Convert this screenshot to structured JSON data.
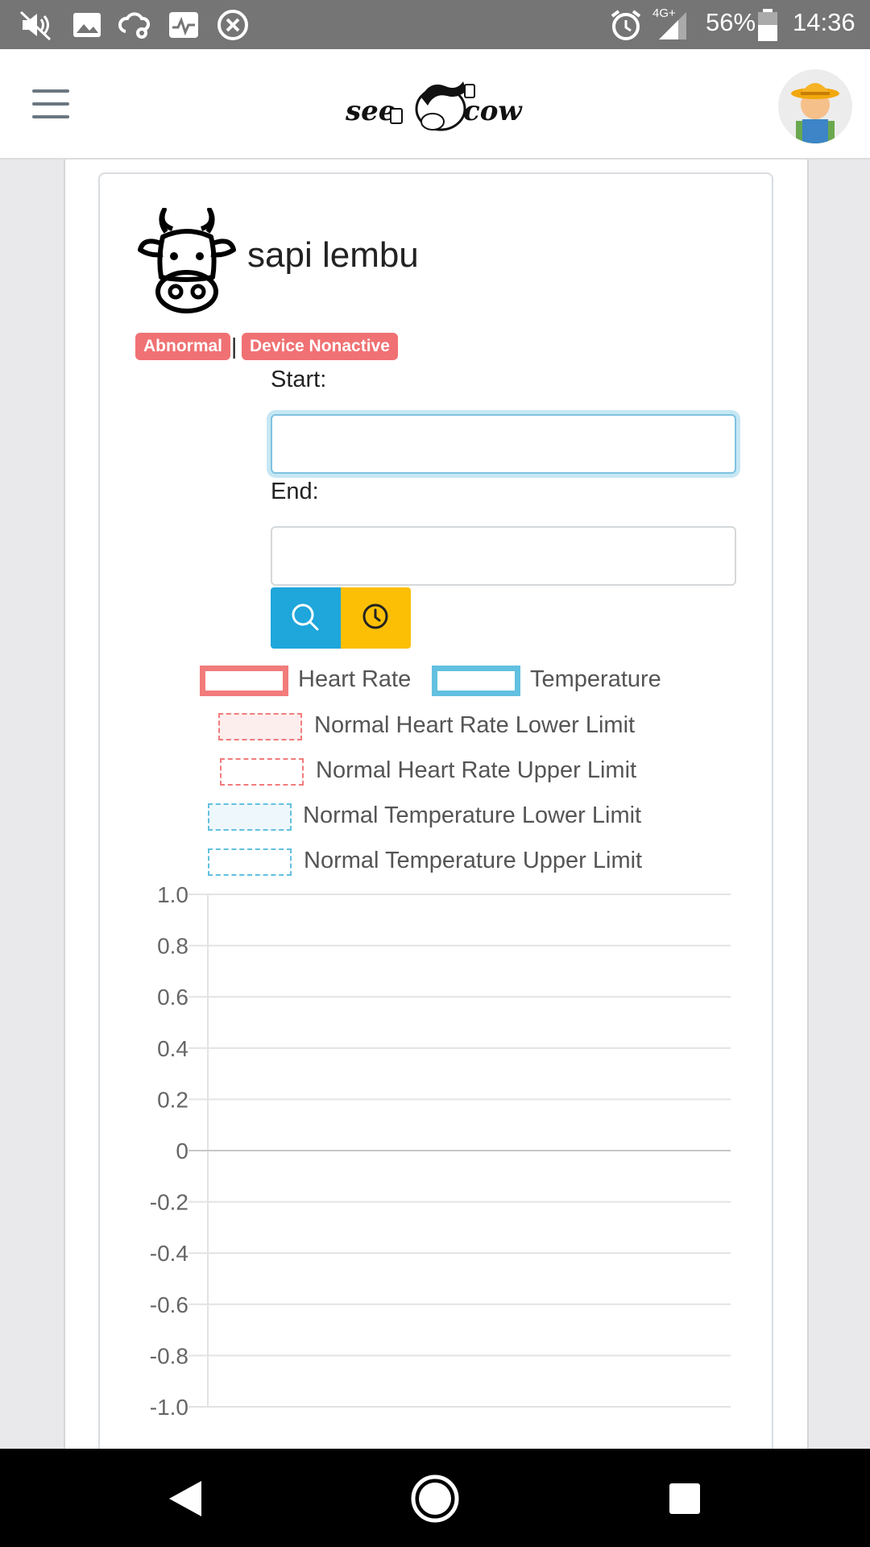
{
  "status_bar": {
    "battery": "56%",
    "network": "4G+",
    "time": "14:36",
    "icons": [
      "mute-icon",
      "image-icon",
      "cloud-settings-icon",
      "pulse-icon",
      "close-circle-icon",
      "alarm-icon",
      "signal-icon",
      "battery-icon"
    ]
  },
  "header": {
    "logo_text": "see cow",
    "menu_icon": "hamburger-icon",
    "avatar_icon": "farmer-avatar-icon"
  },
  "cow": {
    "name": "sapi lembu",
    "icon": "cow-face-icon",
    "badges": [
      "Abnormal",
      "Device Nonactive"
    ],
    "separator": "|"
  },
  "form": {
    "start_label": "Start:",
    "start_value": "",
    "end_label": "End:",
    "end_value": "",
    "search_icon": "search-icon",
    "history_icon": "clock-icon"
  },
  "colors": {
    "heart_rate": "#f27b7b",
    "temperature": "#62c0e0",
    "badge": "#f07173",
    "search_btn": "#1fa6db",
    "history_btn": "#fcbf06"
  },
  "chart_data": {
    "type": "line",
    "legend": [
      "Heart Rate",
      "Temperature",
      "Normal Heart Rate Lower Limit",
      "Normal Heart Rate Upper Limit",
      "Normal Temperature Lower Limit",
      "Normal Temperature Upper Limit"
    ],
    "series": [
      {
        "name": "Heart Rate",
        "values": []
      },
      {
        "name": "Temperature",
        "values": []
      },
      {
        "name": "Normal Heart Rate Lower Limit",
        "values": []
      },
      {
        "name": "Normal Heart Rate Upper Limit",
        "values": []
      },
      {
        "name": "Normal Temperature Lower Limit",
        "values": []
      },
      {
        "name": "Normal Temperature Upper Limit",
        "values": []
      }
    ],
    "yticks": [
      "1.0",
      "0.8",
      "0.6",
      "0.4",
      "0.2",
      "0",
      "-0.2",
      "-0.4",
      "-0.6",
      "-0.8",
      "-1.0"
    ],
    "ylim": [
      -1.0,
      1.0
    ],
    "grid": true,
    "legend_placement": "top"
  },
  "nav_bar": {
    "back_icon": "back-icon",
    "home_icon": "home-icon",
    "recents_icon": "recents-icon"
  }
}
